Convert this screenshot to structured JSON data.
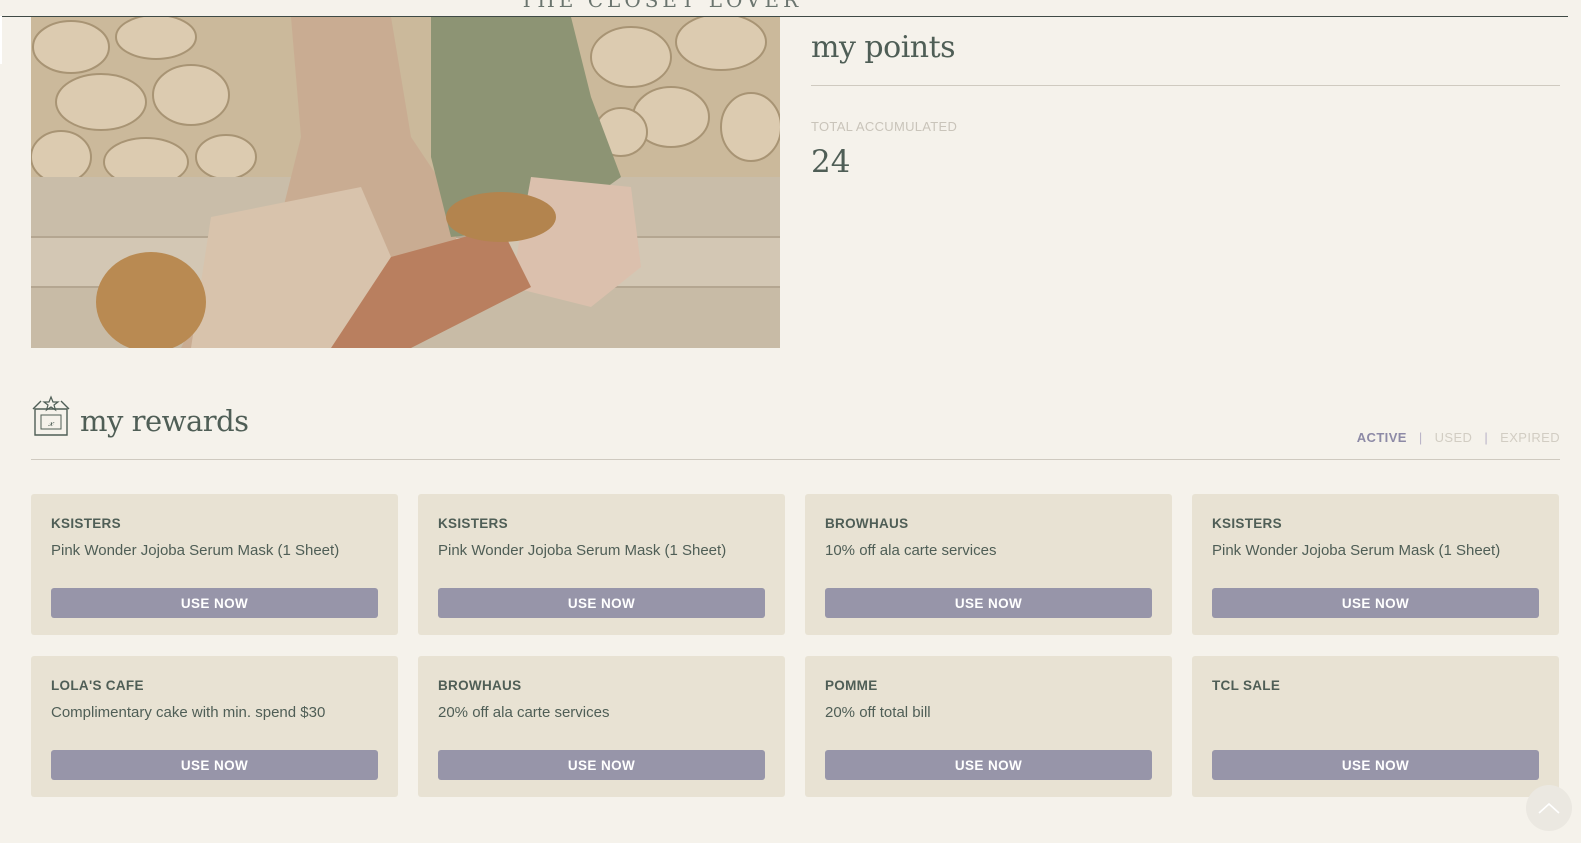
{
  "header": {
    "brand_partial": "THE CLOSET LOVER"
  },
  "points": {
    "title": "my points",
    "total_label": "TOTAL ACCUMULATED",
    "total_value": "24"
  },
  "rewards": {
    "title": "my rewards",
    "filters": [
      {
        "label": "ACTIVE",
        "active": true
      },
      {
        "label": "USED",
        "active": false
      },
      {
        "label": "EXPIRED",
        "active": false
      }
    ],
    "separator": "|",
    "cards": [
      {
        "brand": "KSISTERS",
        "description": "Pink Wonder Jojoba Serum Mask (1 Sheet)",
        "button": "USE NOW"
      },
      {
        "brand": "KSISTERS",
        "description": "Pink Wonder Jojoba Serum Mask (1 Sheet)",
        "button": "USE NOW"
      },
      {
        "brand": "BROWHAUS",
        "description": "10% off ala carte services",
        "button": "USE NOW"
      },
      {
        "brand": "KSISTERS",
        "description": "Pink Wonder Jojoba Serum Mask (1 Sheet)",
        "button": "USE NOW"
      },
      {
        "brand": "LOLA'S CAFE",
        "description": "Complimentary cake with min. spend $30",
        "button": "USE NOW"
      },
      {
        "brand": "BROWHAUS",
        "description": "20% off ala carte services",
        "button": "USE NOW"
      },
      {
        "brand": "POMME",
        "description": "20% off total bill",
        "button": "USE NOW"
      },
      {
        "brand": "TCL SALE",
        "description": "",
        "button": "USE NOW"
      }
    ]
  },
  "colors": {
    "background": "#f5f2eb",
    "card": "#e8e2d3",
    "button": "#9795a9",
    "text": "#4f5e56",
    "filter_active": "#8d8aa6"
  },
  "icons": {
    "rewards": "gift-box-icon",
    "scroll_top": "chevron-up-icon"
  }
}
